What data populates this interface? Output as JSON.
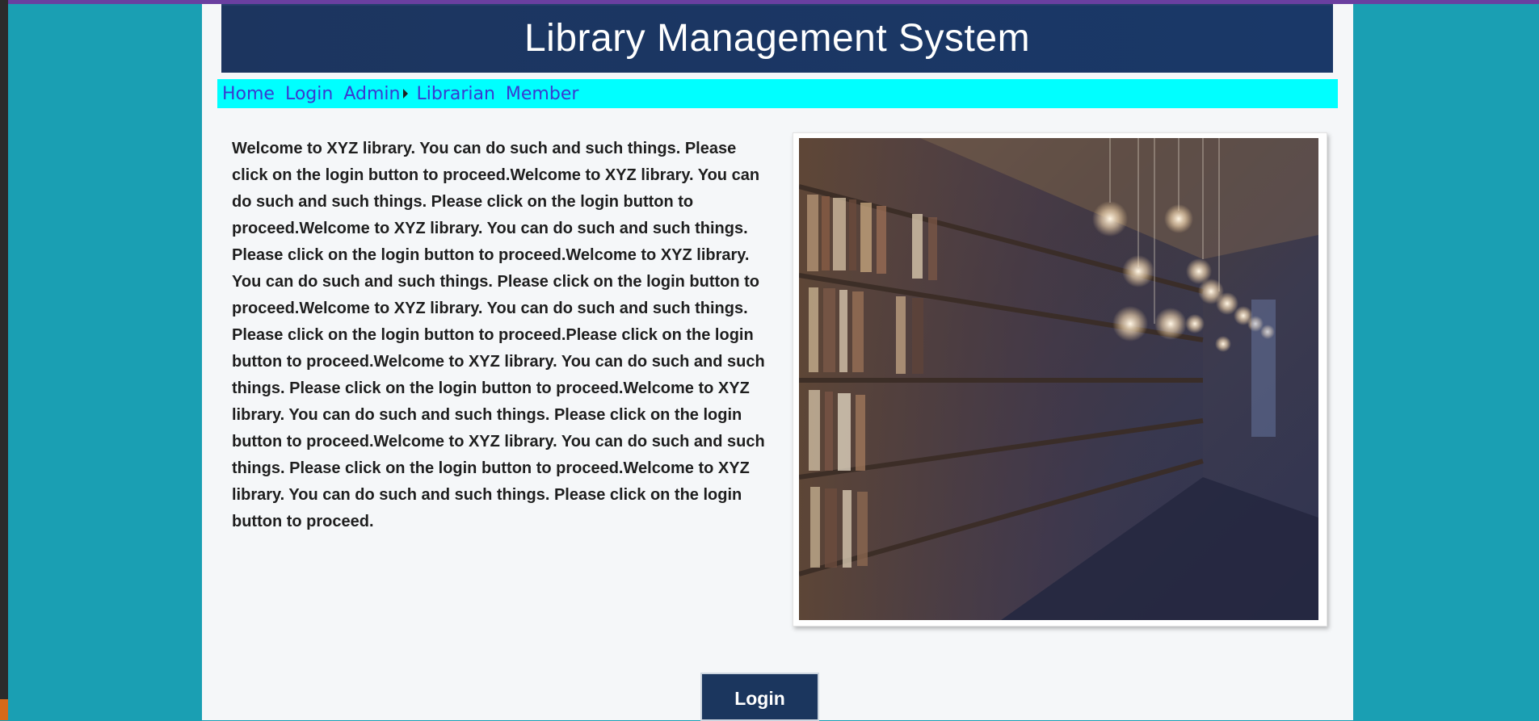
{
  "app": {
    "title": "Library Management System"
  },
  "nav": {
    "items": [
      {
        "label": "Home"
      },
      {
        "label": "Login"
      },
      {
        "label": "Admin",
        "has_submenu": true
      },
      {
        "label": "Librarian"
      },
      {
        "label": "Member"
      }
    ]
  },
  "main": {
    "welcome_text": "Welcome to XYZ library. You can do such and such things. Please click on the login button to proceed.Welcome to XYZ library. You can do such and such things. Please click on the login button to proceed.Welcome to XYZ library. You can do such and such things. Please click on the login button to proceed.Welcome to XYZ library. You can do such and such things. Please click on the login button to proceed.Welcome to XYZ library. You can do such and such things. Please click on the login button to proceed.Please click on the login button to proceed.Welcome to XYZ library. You can do such and such things. Please click on the login button to proceed.Welcome to XYZ library. You can do such and such things. Please click on the login button to proceed.Welcome to XYZ library. You can do such and such things. Please click on the login button to proceed.Welcome to XYZ library. You can do such and such things. Please click on the login button to proceed.",
    "image": "library-bookshelf-photo",
    "login_button": "Login"
  },
  "colors": {
    "page_background": "#1a9fb3",
    "header_background": "#1c355f",
    "nav_background": "#00ffff",
    "nav_link": "#3a3ad0",
    "button_background": "#1b365e"
  }
}
